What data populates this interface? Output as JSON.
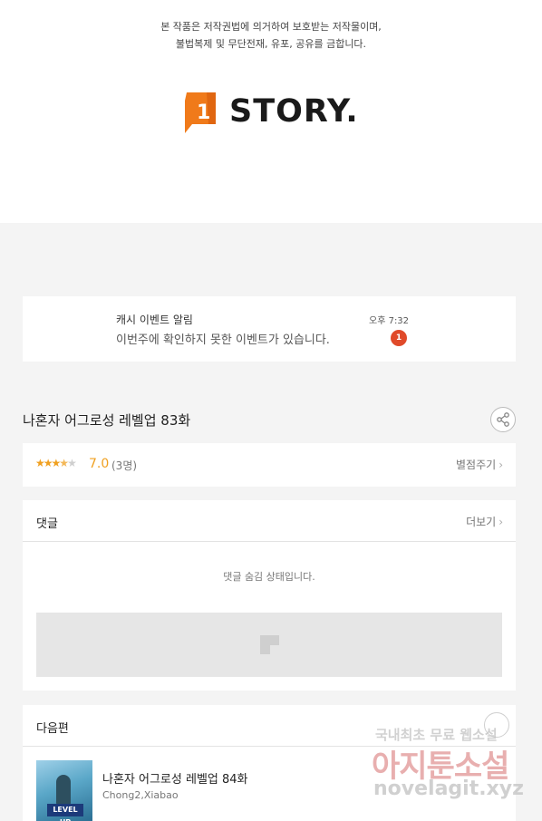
{
  "notice": {
    "line1": "본 작품은 저작권법에 의거하여 보호받는 저작물이며,",
    "line2": "불법복제 및 무단전재, 유포, 공유를 금합니다."
  },
  "brand": {
    "logo_number": "1",
    "logo_text": "STORY.",
    "logo_color": "#f07a1a"
  },
  "push_notification": {
    "title": "캐시 이벤트 알림",
    "time": "오후 7:32",
    "message": "이번주에 확인하지 못한 이벤트가 있습니다.",
    "badge": "1"
  },
  "episode": {
    "title": "나혼자 어그로성 레벨업 83화",
    "share_icon": "share-icon"
  },
  "rating": {
    "stars_filled": 3.5,
    "stars_total": 5,
    "score": "7.0",
    "count": "(3명)",
    "rate_label": "별점주기"
  },
  "comments": {
    "title": "댓글",
    "more_label": "더보기",
    "hidden_message": "댓글 숨김 상태입니다."
  },
  "next_episode": {
    "section_title": "다음편",
    "title": "나혼자 어그로성 레벨업 84화",
    "author": "Chong2,Xiabao",
    "thumb_label": "LEVEL UP"
  },
  "watermark": {
    "line1": "국내최초 무료 웹소설",
    "line2": "아지툰소설",
    "line3": "novelagit.xyz"
  }
}
